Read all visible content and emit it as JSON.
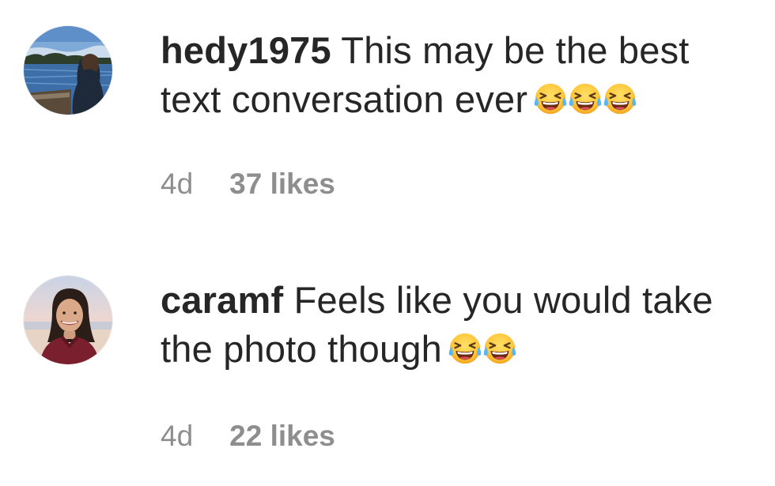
{
  "comments": [
    {
      "username": "hedy1975",
      "text": "This may be the best text conversation ever",
      "emoji": [
        "face-with-tears-of-joy-icon",
        "face-with-tears-of-joy-icon",
        "face-with-tears-of-joy-icon"
      ],
      "time": "4d",
      "likes": "37 likes"
    },
    {
      "username": "caramf",
      "text": "Feels like you would take the photo though",
      "emoji": [
        "face-with-tears-of-joy-icon",
        "face-with-tears-of-joy-icon"
      ],
      "time": "4d",
      "likes": "22 likes"
    }
  ],
  "colors": {
    "text": "#262626",
    "secondary": "#8e8e8e",
    "emoji_face": "#FFC83D",
    "tear": "#5BB7F0"
  }
}
